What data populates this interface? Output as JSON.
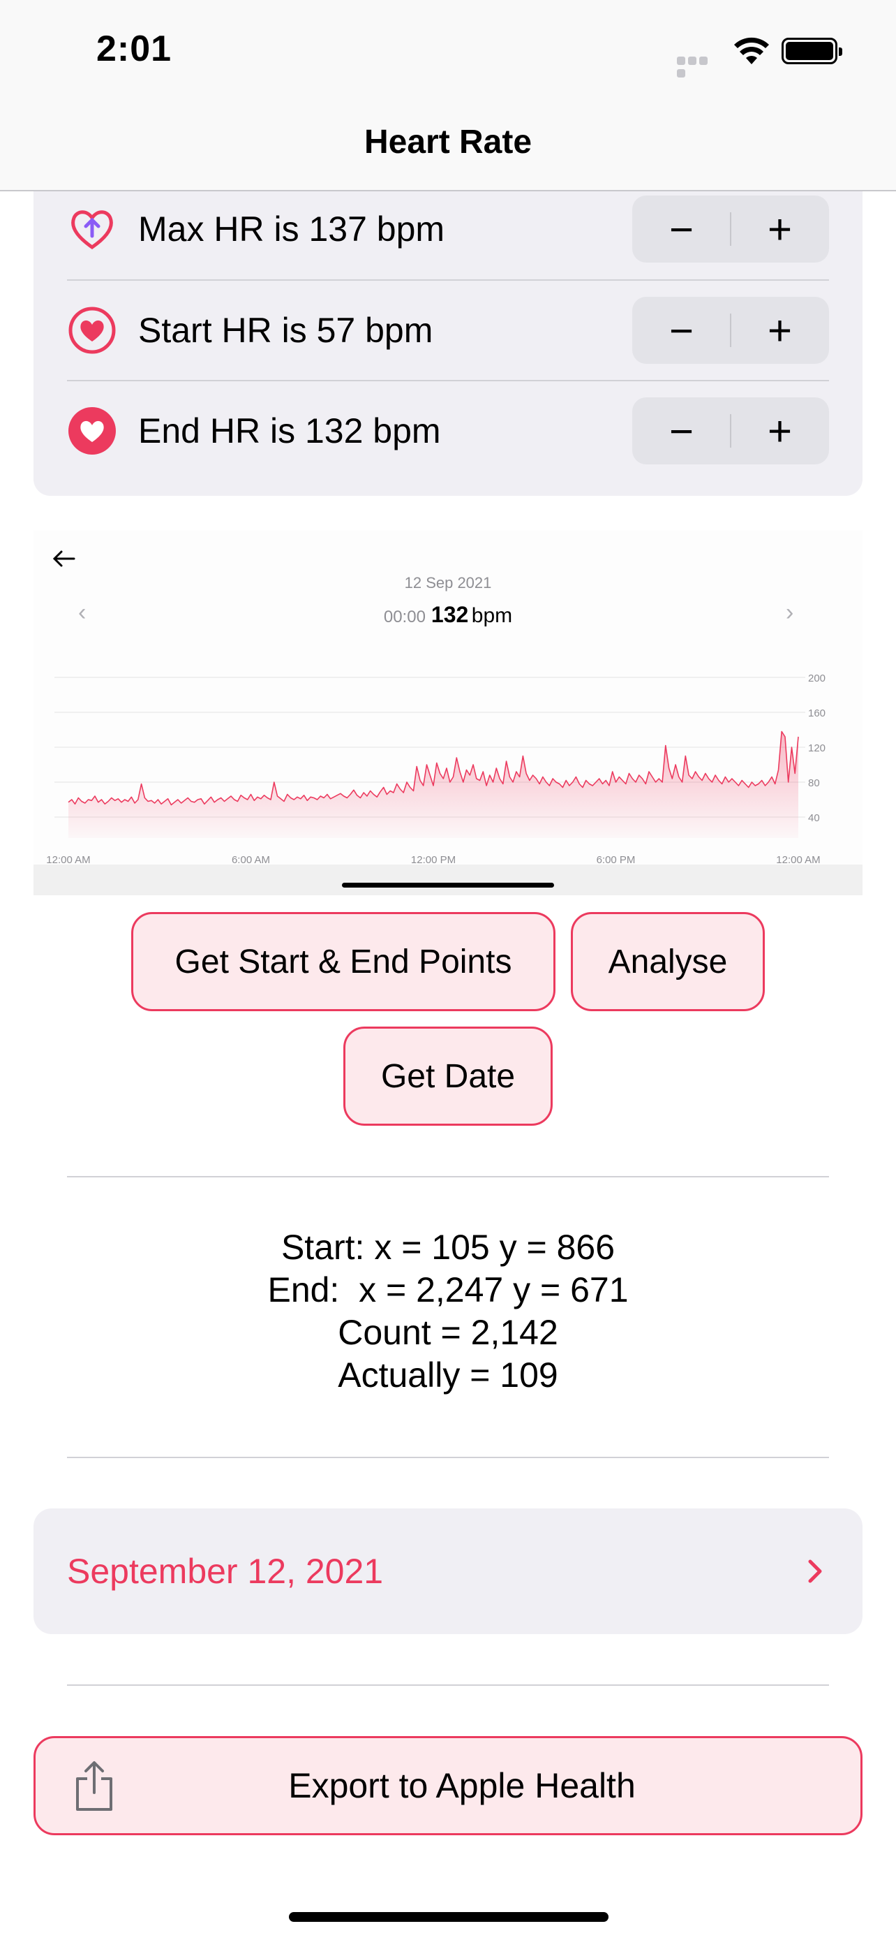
{
  "status_bar": {
    "time": "2:01"
  },
  "nav": {
    "title": "Heart Rate"
  },
  "hr_settings": {
    "rows": [
      {
        "label": "Max HR is 137 bpm",
        "icon": "heart-up-arrow-icon"
      },
      {
        "label": "Start HR is 57 bpm",
        "icon": "heart-ring-icon"
      },
      {
        "label": "End HR is 132 bpm",
        "icon": "heart-filled-icon"
      }
    ],
    "stepper_minus": "−",
    "stepper_plus": "+"
  },
  "chart": {
    "date": "12 Sep 2021",
    "readout_time": "00:00",
    "readout_value": "132",
    "readout_unit": "bpm"
  },
  "chart_data": {
    "type": "area",
    "x_tick_labels": [
      "12:00 AM",
      "6:00 AM",
      "12:00 PM",
      "6:00 PM",
      "12:00 AM"
    ],
    "y_tick_labels": [
      "200",
      "160",
      "120",
      "80",
      "40"
    ],
    "ylim": [
      40,
      200
    ],
    "grid": true,
    "color": "#ec3a5e",
    "values": [
      57,
      60,
      55,
      62,
      58,
      56,
      60,
      59,
      64,
      57,
      60,
      55,
      58,
      62,
      59,
      61,
      57,
      60,
      58,
      63,
      56,
      60,
      78,
      62,
      58,
      59,
      56,
      60,
      55,
      58,
      61,
      54,
      57,
      60,
      56,
      59,
      62,
      58,
      57,
      60,
      61,
      55,
      59,
      63,
      57,
      60,
      62,
      58,
      61,
      64,
      60,
      58,
      65,
      62,
      60,
      66,
      59,
      63,
      61,
      65,
      62,
      60,
      80,
      64,
      61,
      58,
      66,
      62,
      60,
      63,
      61,
      65,
      59,
      63,
      62,
      60,
      64,
      62,
      66,
      61,
      63,
      65,
      67,
      64,
      62,
      66,
      71,
      65,
      62,
      68,
      64,
      70,
      66,
      63,
      69,
      74,
      66,
      70,
      68,
      78,
      72,
      68,
      80,
      74,
      70,
      98,
      82,
      76,
      100,
      88,
      76,
      102,
      90,
      84,
      96,
      80,
      86,
      108,
      92,
      80,
      94,
      88,
      100,
      84,
      82,
      92,
      76,
      88,
      80,
      96,
      84,
      78,
      104,
      86,
      80,
      92,
      86,
      110,
      90,
      82,
      88,
      84,
      78,
      86,
      80,
      76,
      84,
      80,
      78,
      74,
      82,
      76,
      80,
      86,
      78,
      74,
      82,
      78,
      76,
      80,
      84,
      78,
      82,
      76,
      92,
      80,
      86,
      82,
      78,
      90,
      84,
      80,
      88,
      84,
      78,
      92,
      86,
      80,
      84,
      80,
      122,
      96,
      84,
      100,
      86,
      80,
      110,
      88,
      84,
      92,
      86,
      82,
      90,
      84,
      80,
      88,
      82,
      78,
      86,
      80,
      84,
      80,
      76,
      82,
      78,
      74,
      80,
      76,
      78,
      82,
      76,
      80,
      86,
      78,
      94,
      138,
      132,
      80,
      120,
      90,
      132
    ]
  },
  "actions": {
    "get_points": "Get Start & End Points",
    "analyse": "Analyse",
    "get_date": "Get Date"
  },
  "results": {
    "start": "Start: x = 105 y = 866",
    "end": "End:  x = 2,247 y = 671",
    "count": "Count = 2,142",
    "actually": "Actually = 109"
  },
  "date_picker": {
    "label": "September 12, 2021"
  },
  "export": {
    "label": "Export to Apple Health"
  },
  "colors": {
    "accent": "#ec3a5e",
    "pill_bg": "#fde9ec",
    "card_bg": "#f0eff4"
  }
}
